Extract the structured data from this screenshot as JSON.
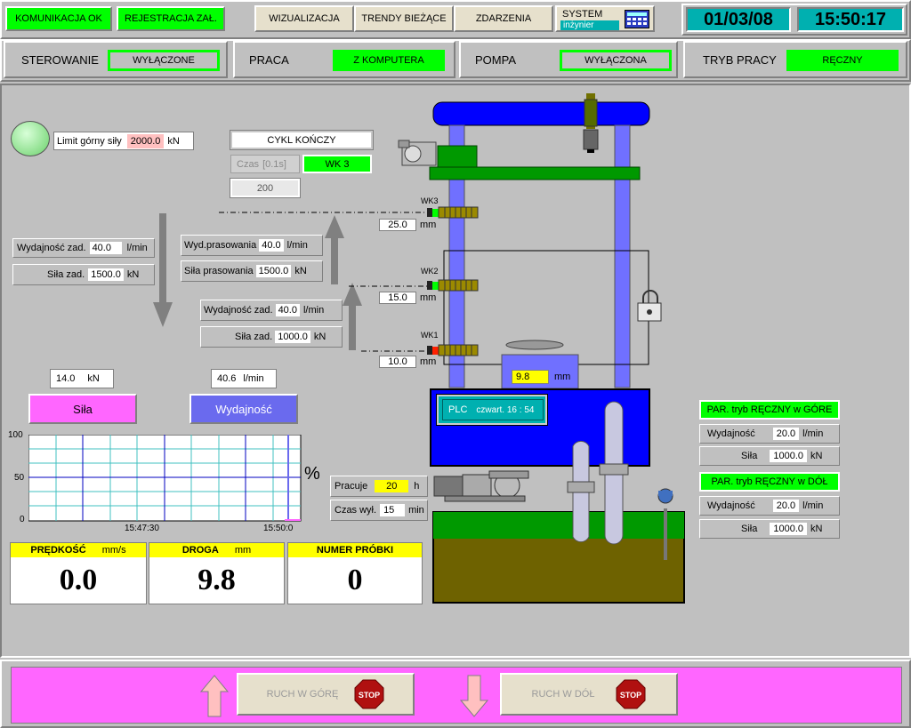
{
  "top": {
    "status1": "KOMUNIKACJA OK",
    "status2": "REJESTRACJA ZAŁ.",
    "nav": [
      "WIZUALIZACJA",
      "TRENDY BIEŻĄCE",
      "ZDARZENIA"
    ],
    "system": "SYSTEM",
    "user": "inżynier",
    "date": "01/03/08",
    "time": "15:50:17"
  },
  "statusbar": {
    "sterowanie_label": "STEROWANIE",
    "sterowanie_val": "WYŁĄCZONE",
    "praca_label": "PRACA",
    "praca_val": "Z KOMPUTERA",
    "pompa_label": "POMPA",
    "pompa_val": "WYŁĄCZONA",
    "tryb_label": "TRYB PRACY",
    "tryb_val": "RĘCZNY"
  },
  "limit": {
    "label": "Limit górny siły",
    "value": "2000.0",
    "unit": "kN"
  },
  "cycle": {
    "title": "CYKL KOŃCZY",
    "czas_label": "Czas",
    "czas_unit": "[0.1s]",
    "wk": "WK 3",
    "value": "200"
  },
  "left_set": {
    "wyd_label": "Wydajność zad.",
    "wyd_val": "40.0",
    "wyd_unit": "l/min",
    "sila_label": "Siła zad.",
    "sila_val": "1500.0",
    "sila_unit": "kN"
  },
  "press_set": {
    "wyd_label": "Wyd.prasowania",
    "wyd_val": "40.0",
    "wyd_unit": "l/min",
    "sila_label": "Siła prasowania",
    "sila_val": "1500.0",
    "sila_unit": "kN"
  },
  "up_set": {
    "wyd_label": "Wydajność zad.",
    "wyd_val": "40.0",
    "wyd_unit": "l/min",
    "sila_label": "Siła zad.",
    "sila_val": "1000.0",
    "sila_unit": "kN"
  },
  "sensors": [
    {
      "label": "WK3",
      "value": "25.0",
      "unit": "mm"
    },
    {
      "label": "WK2",
      "value": "15.0",
      "unit": "mm"
    },
    {
      "label": "WK1",
      "value": "10.0",
      "unit": "mm"
    }
  ],
  "position": {
    "value": "9.8",
    "unit": "mm"
  },
  "plc": {
    "label": "PLC",
    "time": "czwart. 16 : 54"
  },
  "readings": {
    "sila_val": "14.0",
    "sila_unit": "kN",
    "wyd_val": "40.6",
    "wyd_unit": "l/min",
    "sila_btn": "Siła",
    "wyd_btn": "Wydajność"
  },
  "trend": {
    "y_ticks": [
      "100",
      "50",
      "0"
    ],
    "x_ticks": [
      "15:47:30",
      "15:50:0"
    ],
    "unit": "%",
    "sila_current": 14.0,
    "wyd_current": 40.6
  },
  "pump": {
    "pracuje_label": "Pracuje",
    "pracuje_val": "20",
    "pracuje_unit": "h",
    "czas_label": "Czas wył.",
    "czas_val": "15",
    "czas_unit": "min"
  },
  "right": {
    "up_title": "PAR. tryb RĘCZNY w GÓRE",
    "up_wyd_label": "Wydajność",
    "up_wyd_val": "20.0",
    "up_wyd_unit": "l/min",
    "up_sila_label": "Siła",
    "up_sila_val": "1000.0",
    "up_sila_unit": "kN",
    "down_title": "PAR. tryb RĘCZNY w DÓŁ",
    "down_wyd_label": "Wydajność",
    "down_wyd_val": "20.0",
    "down_wyd_unit": "l/min",
    "down_sila_label": "Siła",
    "down_sila_val": "1000.0",
    "down_sila_unit": "kN"
  },
  "bottom_values": [
    {
      "label": "PRĘDKOŚĆ",
      "unit": "mm/s",
      "value": "0.0"
    },
    {
      "label": "DROGA",
      "unit": "mm",
      "value": "9.8"
    },
    {
      "label": "NUMER PRÓBKI",
      "unit": "",
      "value": "0"
    }
  ],
  "controls": {
    "up": "RUCH W GÓRĘ",
    "down": "RUCH W DÓŁ",
    "stop": "STOP"
  },
  "colors": {
    "green": "#00ff00",
    "magenta": "#ff66ff",
    "blue": "#0000ff",
    "steel": "#7070ff",
    "cyan": "#00b0b0",
    "yellow": "#ffff00"
  }
}
